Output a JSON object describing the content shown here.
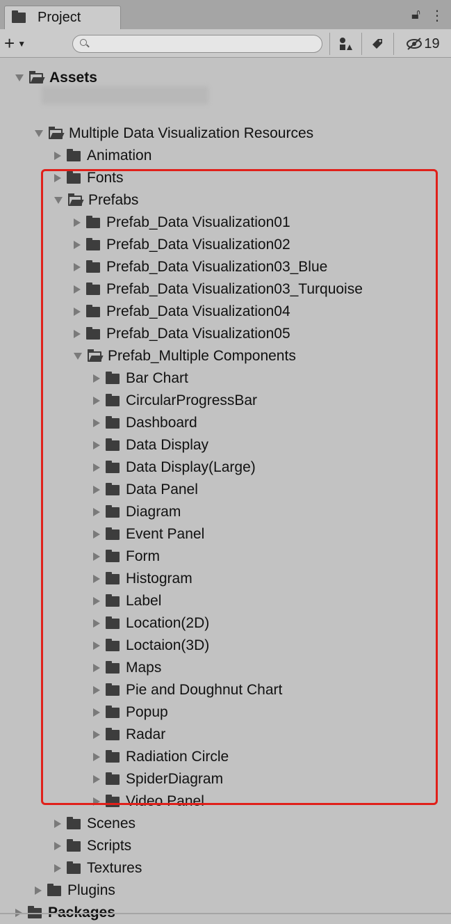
{
  "window": {
    "tab_label": "Project",
    "tab_icon": "folder-icon",
    "lock_icon": "lock-icon",
    "menu_icon": "kebab-menu-icon"
  },
  "toolbar": {
    "create_label": "+",
    "search_placeholder": "",
    "search_value": "",
    "hidden_count": "19"
  },
  "tree": [
    {
      "label": "Assets",
      "depth": 0,
      "expanded": true,
      "bold": true
    },
    {
      "label": "Multiple Data Visualization Resources",
      "depth": 1,
      "expanded": true
    },
    {
      "label": "Animation",
      "depth": 2,
      "expanded": false
    },
    {
      "label": "Fonts",
      "depth": 2,
      "expanded": false
    },
    {
      "label": "Prefabs",
      "depth": 2,
      "expanded": true
    },
    {
      "label": "Prefab_Data Visualization01",
      "depth": 3,
      "expanded": false
    },
    {
      "label": "Prefab_Data Visualization02",
      "depth": 3,
      "expanded": false
    },
    {
      "label": "Prefab_Data Visualization03_Blue",
      "depth": 3,
      "expanded": false
    },
    {
      "label": "Prefab_Data Visualization03_Turquoise",
      "depth": 3,
      "expanded": false
    },
    {
      "label": "Prefab_Data Visualization04",
      "depth": 3,
      "expanded": false
    },
    {
      "label": "Prefab_Data Visualization05",
      "depth": 3,
      "expanded": false
    },
    {
      "label": "Prefab_Multiple Components",
      "depth": 3,
      "expanded": true
    },
    {
      "label": "Bar Chart",
      "depth": 4,
      "expanded": false
    },
    {
      "label": "CircularProgressBar",
      "depth": 4,
      "expanded": false
    },
    {
      "label": "Dashboard",
      "depth": 4,
      "expanded": false
    },
    {
      "label": "Data Display",
      "depth": 4,
      "expanded": false
    },
    {
      "label": "Data Display(Large)",
      "depth": 4,
      "expanded": false
    },
    {
      "label": "Data Panel",
      "depth": 4,
      "expanded": false
    },
    {
      "label": "Diagram",
      "depth": 4,
      "expanded": false
    },
    {
      "label": "Event Panel",
      "depth": 4,
      "expanded": false
    },
    {
      "label": "Form",
      "depth": 4,
      "expanded": false
    },
    {
      "label": "Histogram",
      "depth": 4,
      "expanded": false
    },
    {
      "label": "Label",
      "depth": 4,
      "expanded": false
    },
    {
      "label": "Location(2D)",
      "depth": 4,
      "expanded": false
    },
    {
      "label": "Loctaion(3D)",
      "depth": 4,
      "expanded": false
    },
    {
      "label": "Maps",
      "depth": 4,
      "expanded": false
    },
    {
      "label": "Pie and Doughnut Chart",
      "depth": 4,
      "expanded": false
    },
    {
      "label": "Popup",
      "depth": 4,
      "expanded": false
    },
    {
      "label": "Radar",
      "depth": 4,
      "expanded": false
    },
    {
      "label": "Radiation Circle",
      "depth": 4,
      "expanded": false
    },
    {
      "label": "SpiderDiagram",
      "depth": 4,
      "expanded": false
    },
    {
      "label": "Video Panel",
      "depth": 4,
      "expanded": false
    },
    {
      "label": "Scenes",
      "depth": 2,
      "expanded": false
    },
    {
      "label": "Scripts",
      "depth": 2,
      "expanded": false
    },
    {
      "label": "Textures",
      "depth": 2,
      "expanded": false
    },
    {
      "label": "Plugins",
      "depth": 1,
      "expanded": false
    },
    {
      "label": "Packages",
      "depth": 0,
      "expanded": false,
      "bold": true
    }
  ],
  "colors": {
    "panel_bg": "#c2c2c2",
    "highlight_border": "#e0201a",
    "icon": "#3d3d3d"
  }
}
